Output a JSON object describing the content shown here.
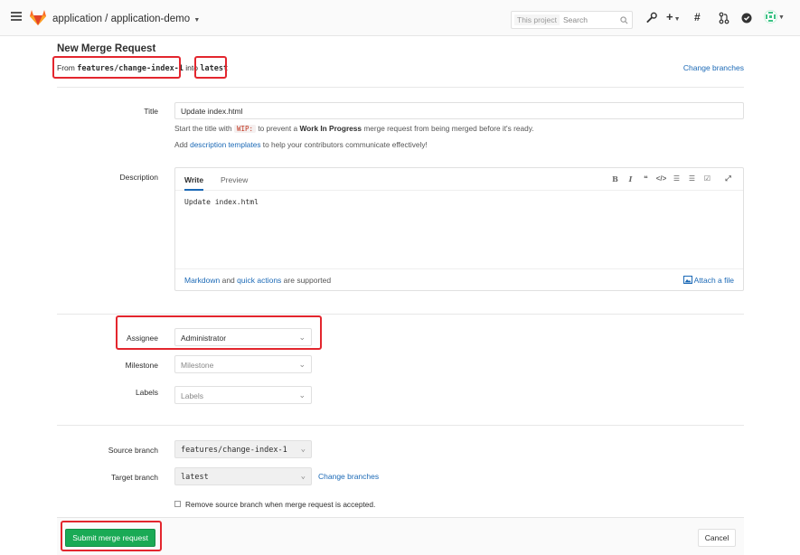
{
  "header": {
    "project_path": "application / application-demo",
    "search_scope": "This project",
    "search_placeholder": "Search"
  },
  "page": {
    "title": "New Merge Request",
    "from_prefix": "From",
    "source_branch": "features/change-index-1",
    "into_word": "into",
    "target_branch": "latest",
    "change_branches": "Change branches"
  },
  "form": {
    "title_label": "Title",
    "title_value": "Update index.html",
    "wip_help_1": "Start the title with",
    "wip_code": "WIP:",
    "wip_help_2": "to prevent a",
    "wip_help_bold": "Work In Progress",
    "wip_help_3": "merge request from being merged before it's ready.",
    "tpl_help_1": "Add",
    "tpl_help_link": "description templates",
    "tpl_help_2": "to help your contributors communicate effectively!",
    "description_label": "Description",
    "tab_write": "Write",
    "tab_preview": "Preview",
    "description_value": "Update index.html",
    "markdown_link": "Markdown",
    "and_word": "and",
    "quick_actions_link": "quick actions",
    "supported_text": "are supported",
    "attach_file": "Attach a file",
    "assignee_label": "Assignee",
    "assignee_value": "Administrator",
    "milestone_label": "Milestone",
    "milestone_value": "Milestone",
    "labels_label": "Labels",
    "labels_value": "Labels",
    "source_branch_label": "Source branch",
    "source_branch_value": "features/change-index-1",
    "target_branch_label": "Target branch",
    "target_branch_value": "latest",
    "change_branches": "Change branches",
    "remove_source_label": "Remove source branch when merge request is accepted.",
    "submit": "Submit merge request",
    "cancel": "Cancel"
  },
  "colors": {
    "accent": "#1b69b6",
    "submit": "#1aaa55",
    "annotation": "#e3262e"
  }
}
